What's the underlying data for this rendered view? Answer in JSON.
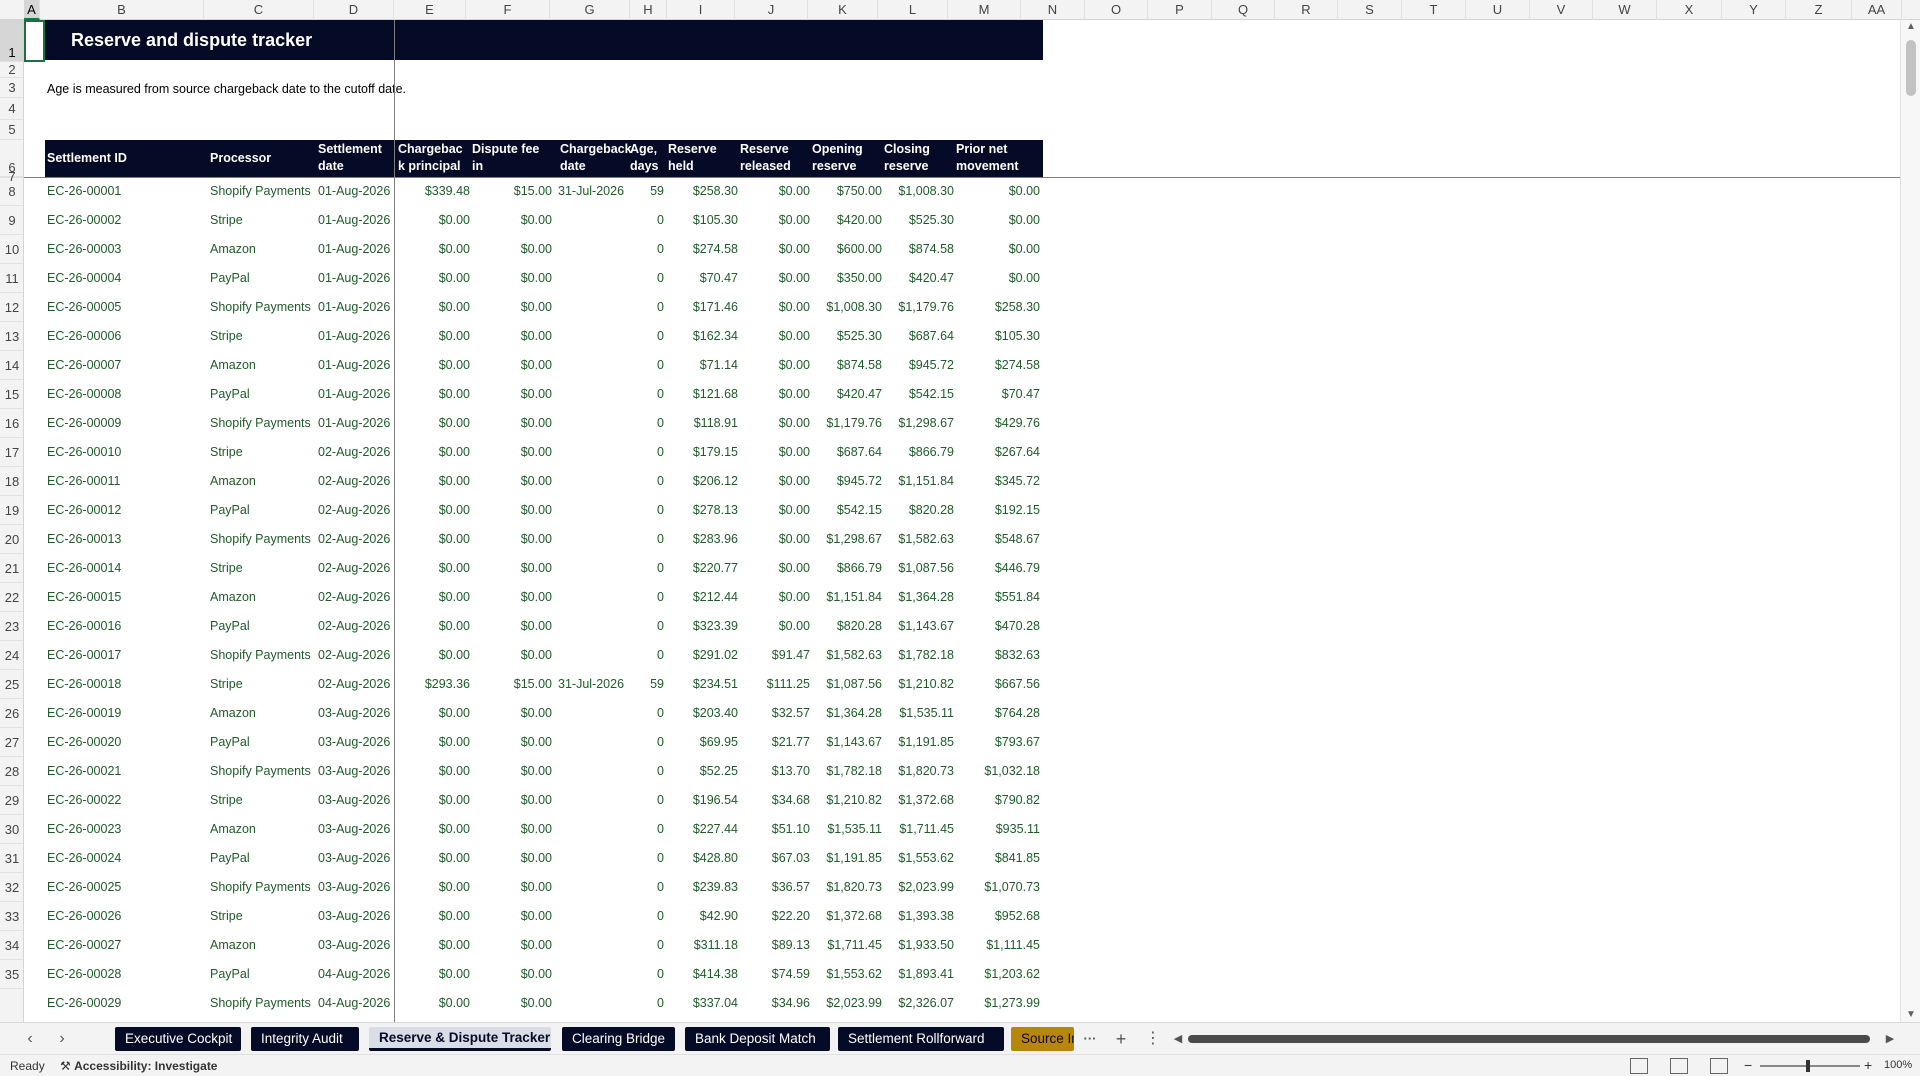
{
  "colors": {
    "header_navy": "#050a26",
    "data_green": "#1f5c2a",
    "tab_gold": "#b8860b",
    "selection_green": "#1e6e42"
  },
  "sheet": {
    "title": "Reserve and dispute tracker",
    "note": "Age is measured from source chargeback date to the cutoff date."
  },
  "columns": [
    "A",
    "B",
    "C",
    "D",
    "E",
    "F",
    "G",
    "H",
    "I",
    "J",
    "K",
    "L",
    "M",
    "N",
    "O",
    "P",
    "Q",
    "R",
    "S",
    "T",
    "U",
    "V",
    "W",
    "X",
    "Y",
    "Z",
    "AA"
  ],
  "row_numbers": [
    "1",
    "2",
    "3",
    "4",
    "5",
    "6",
    "7",
    "8",
    "9",
    "10",
    "11",
    "12",
    "13",
    "14",
    "15",
    "16",
    "17",
    "18",
    "19",
    "20",
    "21",
    "22",
    "23",
    "24",
    "25",
    "26",
    "27",
    "28",
    "29",
    "30",
    "31",
    "32",
    "33",
    "34",
    "35"
  ],
  "headers": [
    "Settlement ID",
    "Processor",
    "Settlement date",
    "Chargebac k principal",
    "Dispute fee in processing",
    "Chargeback date",
    "Age, days",
    "Reserve held",
    "Reserve released",
    "Opening reserve",
    "Closing reserve",
    "Prior net movement"
  ],
  "rows": [
    [
      "EC-26-00001",
      "Shopify Payments",
      "01-Aug-2026",
      "$339.48",
      "$15.00",
      "31-Jul-2026",
      "59",
      "$258.30",
      "$0.00",
      "$750.00",
      "$1,008.30",
      "$0.00"
    ],
    [
      "EC-26-00002",
      "Stripe",
      "01-Aug-2026",
      "$0.00",
      "$0.00",
      "",
      "0",
      "$105.30",
      "$0.00",
      "$420.00",
      "$525.30",
      "$0.00"
    ],
    [
      "EC-26-00003",
      "Amazon",
      "01-Aug-2026",
      "$0.00",
      "$0.00",
      "",
      "0",
      "$274.58",
      "$0.00",
      "$600.00",
      "$874.58",
      "$0.00"
    ],
    [
      "EC-26-00004",
      "PayPal",
      "01-Aug-2026",
      "$0.00",
      "$0.00",
      "",
      "0",
      "$70.47",
      "$0.00",
      "$350.00",
      "$420.47",
      "$0.00"
    ],
    [
      "EC-26-00005",
      "Shopify Payments",
      "01-Aug-2026",
      "$0.00",
      "$0.00",
      "",
      "0",
      "$171.46",
      "$0.00",
      "$1,008.30",
      "$1,179.76",
      "$258.30"
    ],
    [
      "EC-26-00006",
      "Stripe",
      "01-Aug-2026",
      "$0.00",
      "$0.00",
      "",
      "0",
      "$162.34",
      "$0.00",
      "$525.30",
      "$687.64",
      "$105.30"
    ],
    [
      "EC-26-00007",
      "Amazon",
      "01-Aug-2026",
      "$0.00",
      "$0.00",
      "",
      "0",
      "$71.14",
      "$0.00",
      "$874.58",
      "$945.72",
      "$274.58"
    ],
    [
      "EC-26-00008",
      "PayPal",
      "01-Aug-2026",
      "$0.00",
      "$0.00",
      "",
      "0",
      "$121.68",
      "$0.00",
      "$420.47",
      "$542.15",
      "$70.47"
    ],
    [
      "EC-26-00009",
      "Shopify Payments",
      "01-Aug-2026",
      "$0.00",
      "$0.00",
      "",
      "0",
      "$118.91",
      "$0.00",
      "$1,179.76",
      "$1,298.67",
      "$429.76"
    ],
    [
      "EC-26-00010",
      "Stripe",
      "02-Aug-2026",
      "$0.00",
      "$0.00",
      "",
      "0",
      "$179.15",
      "$0.00",
      "$687.64",
      "$866.79",
      "$267.64"
    ],
    [
      "EC-26-00011",
      "Amazon",
      "02-Aug-2026",
      "$0.00",
      "$0.00",
      "",
      "0",
      "$206.12",
      "$0.00",
      "$945.72",
      "$1,151.84",
      "$345.72"
    ],
    [
      "EC-26-00012",
      "PayPal",
      "02-Aug-2026",
      "$0.00",
      "$0.00",
      "",
      "0",
      "$278.13",
      "$0.00",
      "$542.15",
      "$820.28",
      "$192.15"
    ],
    [
      "EC-26-00013",
      "Shopify Payments",
      "02-Aug-2026",
      "$0.00",
      "$0.00",
      "",
      "0",
      "$283.96",
      "$0.00",
      "$1,298.67",
      "$1,582.63",
      "$548.67"
    ],
    [
      "EC-26-00014",
      "Stripe",
      "02-Aug-2026",
      "$0.00",
      "$0.00",
      "",
      "0",
      "$220.77",
      "$0.00",
      "$866.79",
      "$1,087.56",
      "$446.79"
    ],
    [
      "EC-26-00015",
      "Amazon",
      "02-Aug-2026",
      "$0.00",
      "$0.00",
      "",
      "0",
      "$212.44",
      "$0.00",
      "$1,151.84",
      "$1,364.28",
      "$551.84"
    ],
    [
      "EC-26-00016",
      "PayPal",
      "02-Aug-2026",
      "$0.00",
      "$0.00",
      "",
      "0",
      "$323.39",
      "$0.00",
      "$820.28",
      "$1,143.67",
      "$470.28"
    ],
    [
      "EC-26-00017",
      "Shopify Payments",
      "02-Aug-2026",
      "$0.00",
      "$0.00",
      "",
      "0",
      "$291.02",
      "$91.47",
      "$1,582.63",
      "$1,782.18",
      "$832.63"
    ],
    [
      "EC-26-00018",
      "Stripe",
      "02-Aug-2026",
      "$293.36",
      "$15.00",
      "31-Jul-2026",
      "59",
      "$234.51",
      "$111.25",
      "$1,087.56",
      "$1,210.82",
      "$667.56"
    ],
    [
      "EC-26-00019",
      "Amazon",
      "03-Aug-2026",
      "$0.00",
      "$0.00",
      "",
      "0",
      "$203.40",
      "$32.57",
      "$1,364.28",
      "$1,535.11",
      "$764.28"
    ],
    [
      "EC-26-00020",
      "PayPal",
      "03-Aug-2026",
      "$0.00",
      "$0.00",
      "",
      "0",
      "$69.95",
      "$21.77",
      "$1,143.67",
      "$1,191.85",
      "$793.67"
    ],
    [
      "EC-26-00021",
      "Shopify Payments",
      "03-Aug-2026",
      "$0.00",
      "$0.00",
      "",
      "0",
      "$52.25",
      "$13.70",
      "$1,782.18",
      "$1,820.73",
      "$1,032.18"
    ],
    [
      "EC-26-00022",
      "Stripe",
      "03-Aug-2026",
      "$0.00",
      "$0.00",
      "",
      "0",
      "$196.54",
      "$34.68",
      "$1,210.82",
      "$1,372.68",
      "$790.82"
    ],
    [
      "EC-26-00023",
      "Amazon",
      "03-Aug-2026",
      "$0.00",
      "$0.00",
      "",
      "0",
      "$227.44",
      "$51.10",
      "$1,535.11",
      "$1,711.45",
      "$935.11"
    ],
    [
      "EC-26-00024",
      "PayPal",
      "03-Aug-2026",
      "$0.00",
      "$0.00",
      "",
      "0",
      "$428.80",
      "$67.03",
      "$1,191.85",
      "$1,553.62",
      "$841.85"
    ],
    [
      "EC-26-00025",
      "Shopify Payments",
      "03-Aug-2026",
      "$0.00",
      "$0.00",
      "",
      "0",
      "$239.83",
      "$36.57",
      "$1,820.73",
      "$2,023.99",
      "$1,070.73"
    ],
    [
      "EC-26-00026",
      "Stripe",
      "03-Aug-2026",
      "$0.00",
      "$0.00",
      "",
      "0",
      "$42.90",
      "$22.20",
      "$1,372.68",
      "$1,393.38",
      "$952.68"
    ],
    [
      "EC-26-00027",
      "Amazon",
      "03-Aug-2026",
      "$0.00",
      "$0.00",
      "",
      "0",
      "$311.18",
      "$89.13",
      "$1,711.45",
      "$1,933.50",
      "$1,111.45"
    ],
    [
      "EC-26-00028",
      "PayPal",
      "04-Aug-2026",
      "$0.00",
      "$0.00",
      "",
      "0",
      "$414.38",
      "$74.59",
      "$1,553.62",
      "$1,893.41",
      "$1,203.62"
    ],
    [
      "EC-26-00029",
      "Shopify Payments",
      "04-Aug-2026",
      "$0.00",
      "$0.00",
      "",
      "0",
      "$337.04",
      "$34.96",
      "$2,023.99",
      "$2,326.07",
      "$1,273.99"
    ]
  ],
  "tabs": [
    {
      "label": "Executive Cockpit",
      "state": "normal"
    },
    {
      "label": "Integrity Audit",
      "state": "normal"
    },
    {
      "label": "Reserve & Dispute Tracker",
      "state": "active"
    },
    {
      "label": "Clearing Bridge",
      "state": "normal"
    },
    {
      "label": "Bank Deposit Match",
      "state": "normal"
    },
    {
      "label": "Settlement Rollforward",
      "state": "normal"
    },
    {
      "label": "Source Ir",
      "state": "gold"
    }
  ],
  "tab_controls": {
    "more": "···",
    "add": "+",
    "menu": "⋮"
  },
  "status": {
    "ready": "Ready",
    "accessibility": "Accessibility: Investigate",
    "zoom": "100%"
  }
}
